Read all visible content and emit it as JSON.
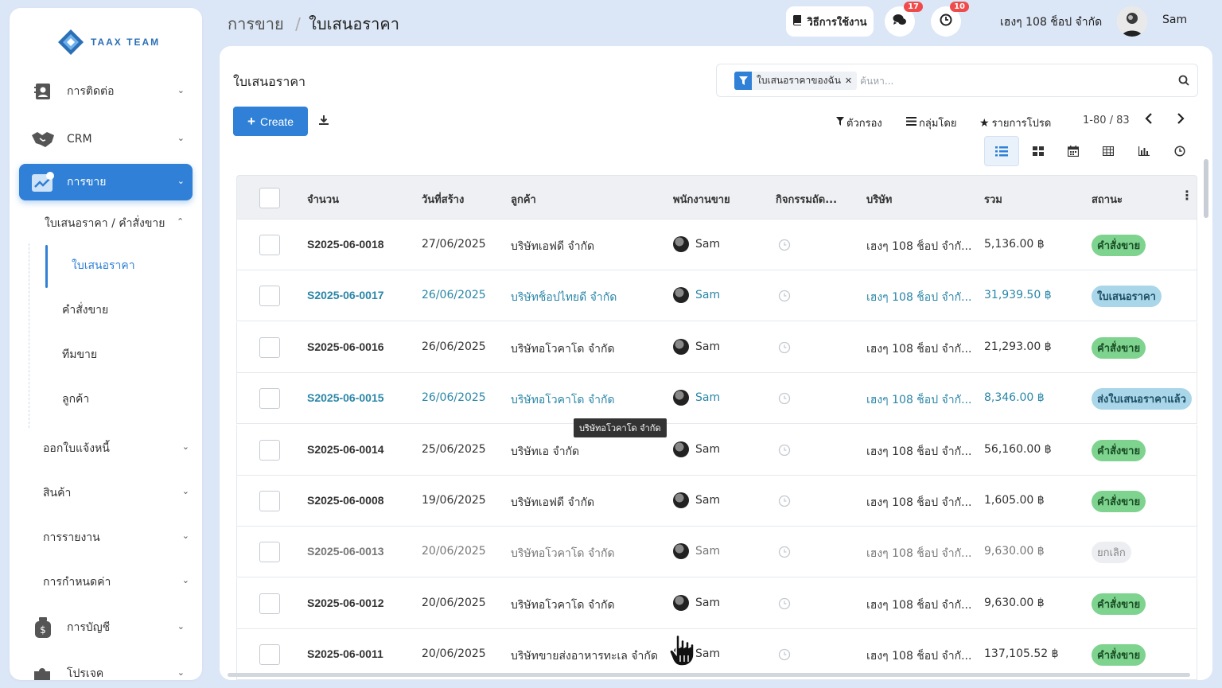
{
  "brand": {
    "name": "TAAX TEAM",
    "accent": "#2f80d6"
  },
  "sidebar": {
    "items": [
      {
        "label": "การติดต่อ",
        "icon": "contact-card-icon"
      },
      {
        "label": "CRM",
        "icon": "handshake-icon"
      },
      {
        "label": "การขาย",
        "icon": "sales-chart-icon"
      }
    ],
    "sales_sub": {
      "label": "ใบเสนอราคา / คำสั่งขาย",
      "children": [
        "ใบเสนอราคา",
        "คำสั่งขาย",
        "ทีมขาย",
        "ลูกค้า"
      ]
    },
    "groups": [
      "ออกใบแจ้งหนี้",
      "สินค้า",
      "การรายงาน",
      "การกำหนดค่า"
    ],
    "bottom_items": [
      {
        "label": "การบัญชี",
        "icon": "money-bag-icon"
      },
      {
        "label": "โปรเจค",
        "icon": "puzzle-icon"
      }
    ]
  },
  "topbar": {
    "breadcrumb_parent": "การขาย",
    "breadcrumb_sep": "/",
    "breadcrumb_current": "ใบเสนอราคา",
    "help_label": "วิธีการใช้งาน",
    "chat_badge": "17",
    "activity_badge": "10",
    "company": "เฮงๆ 108 ช็อป จำกัด",
    "user": "Sam"
  },
  "main": {
    "title": "ใบเสนอราคา",
    "search": {
      "facet": "ใบเสนอราคาของฉัน",
      "placeholder": "ค้นหา..."
    },
    "create_label": "Create",
    "filters_label": "ตัวกรอง",
    "groupby_label": "กลุ่มโดย",
    "favorites_label": "รายการโปรด",
    "pager": "1-80 / 83"
  },
  "table": {
    "columns": [
      "จำนวน",
      "วันที่สร้าง",
      "ลูกค้า",
      "พนักงานขาย",
      "กิจกรรมถัด...",
      "บริษัท",
      "รวม",
      "สถานะ"
    ],
    "rows": [
      {
        "number": "S2025-06-0018",
        "date": "27/06/2025",
        "customer": "บริษัทเอฟดี จำกัด",
        "salesperson": "Sam",
        "company": "เฮงๆ 108 ช็อป จำกั...",
        "total": "5,136.00 ฿",
        "status": "คำสั่งขาย",
        "status_kind": "green",
        "style": ""
      },
      {
        "number": "S2025-06-0017",
        "date": "26/06/2025",
        "customer": "บริษัทช็อปไทยดี จำกัด",
        "salesperson": "Sam",
        "company": "เฮงๆ 108 ช็อป จำกั...",
        "total": "31,939.50 ฿",
        "status": "ใบเสนอราคา",
        "status_kind": "blue",
        "style": "hl"
      },
      {
        "number": "S2025-06-0016",
        "date": "26/06/2025",
        "customer": "บริษัทอโวคาโด จำกัด",
        "salesperson": "Sam",
        "company": "เฮงๆ 108 ช็อป จำกั...",
        "total": "21,293.00 ฿",
        "status": "คำสั่งขาย",
        "status_kind": "green",
        "style": ""
      },
      {
        "number": "S2025-06-0015",
        "date": "26/06/2025",
        "customer": "บริษัทอโวคาโด จำกัด",
        "salesperson": "Sam",
        "company": "เฮงๆ 108 ช็อป จำกั...",
        "total": "8,346.00 ฿",
        "status": "ส่งใบเสนอราคาแล้ว",
        "status_kind": "blue",
        "style": "hl"
      },
      {
        "number": "S2025-06-0014",
        "date": "25/06/2025",
        "customer": "บริษัทเอ จำกัด",
        "salesperson": "Sam",
        "company": "เฮงๆ 108 ช็อป จำกั...",
        "total": "56,160.00 ฿",
        "status": "คำสั่งขาย",
        "status_kind": "green",
        "style": ""
      },
      {
        "number": "S2025-06-0008",
        "date": "19/06/2025",
        "customer": "บริษัทเอฟดี จำกัด",
        "salesperson": "Sam",
        "company": "เฮงๆ 108 ช็อป จำกั...",
        "total": "1,605.00 ฿",
        "status": "คำสั่งขาย",
        "status_kind": "green",
        "style": ""
      },
      {
        "number": "S2025-06-0013",
        "date": "20/06/2025",
        "customer": "บริษัทอโวคาโด จำกัด",
        "salesperson": "Sam",
        "company": "เฮงๆ 108 ช็อป จำกั...",
        "total": "9,630.00 ฿",
        "status": "ยกเลิก",
        "status_kind": "grey",
        "style": "muted"
      },
      {
        "number": "S2025-06-0012",
        "date": "20/06/2025",
        "customer": "บริษัทอโวคาโด จำกัด",
        "salesperson": "Sam",
        "company": "เฮงๆ 108 ช็อป จำกั...",
        "total": "9,630.00 ฿",
        "status": "คำสั่งขาย",
        "status_kind": "green",
        "style": ""
      },
      {
        "number": "S2025-06-0011",
        "date": "20/06/2025",
        "customer": "บริษัทขายส่งอาหารทะเล จำกัด",
        "salesperson": "Sam",
        "company": "เฮงๆ 108 ช็อป จำกั...",
        "total": "137,105.52 ฿",
        "status": "คำสั่งขาย",
        "status_kind": "green",
        "style": ""
      }
    ],
    "tooltip": "บริษัทอโวคาโด จำกัด"
  }
}
